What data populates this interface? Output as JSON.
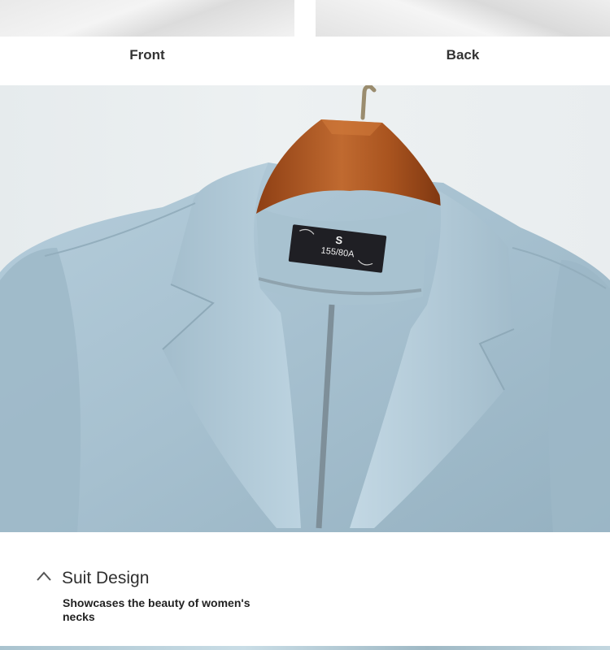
{
  "gallery": {
    "front_caption": "Front",
    "back_caption": "Back"
  },
  "garment_label": {
    "size": "S",
    "measurement": "155/80A"
  },
  "feature": {
    "icon": "chevron-up-icon",
    "title": "Suit Design",
    "description": "Showcases the beauty of women's necks"
  },
  "colors": {
    "jacket": "#a8c3d3",
    "hanger": "#b25a25",
    "text": "#2f2f2f"
  }
}
